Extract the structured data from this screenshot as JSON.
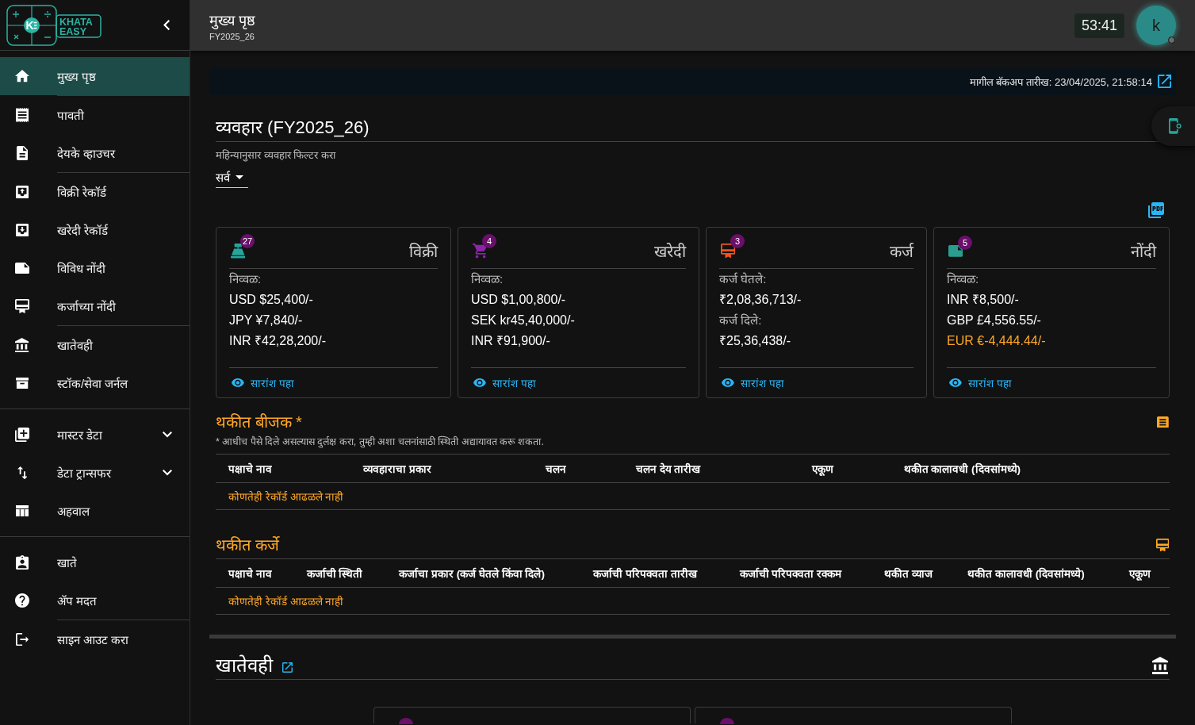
{
  "sidebar": {
    "logo": {
      "mark": "K",
      "words": [
        "KHATA",
        "EASY"
      ]
    },
    "sections": [
      {
        "groups": [
          {
            "items": [
              {
                "label": "मुख्य पृष्ठ",
                "kind": "link",
                "selected": true
              }
            ]
          },
          {
            "items": [
              {
                "label": "पावती",
                "kind": "link",
                "selected": false
              },
              {
                "label": "देयके व्हाउचर",
                "kind": "link",
                "selected": false
              }
            ]
          },
          {
            "items": [
              {
                "label": "विक्री रेकॉर्ड",
                "kind": "link",
                "selected": false
              },
              {
                "label": "खरेदी रेकॉर्ड",
                "kind": "link",
                "selected": false
              },
              {
                "label": "विविध नोंदी",
                "kind": "link",
                "selected": false
              },
              {
                "label": "कर्जाच्या नोंदी",
                "kind": "link",
                "selected": false
              }
            ]
          },
          {
            "items": [
              {
                "label": "खातेवही",
                "kind": "link",
                "selected": false
              },
              {
                "label": "स्टॉक/सेवा जर्नल",
                "kind": "link",
                "selected": false
              }
            ]
          }
        ]
      },
      {
        "groups": [
          {
            "items": [
              {
                "label": "मास्टर डेटा",
                "kind": "menu",
                "expanded": false,
                "selected": false
              },
              {
                "label": "डेटा ट्रान्सफर",
                "kind": "menu",
                "expanded": false,
                "selected": false
              },
              {
                "label": "अहवाल",
                "kind": "link",
                "selected": false
              }
            ]
          }
        ]
      },
      {
        "groups": [
          {
            "items": [
              {
                "label": "खाते",
                "kind": "link",
                "selected": false
              },
              {
                "label": "ॲप मदत",
                "kind": "link",
                "selected": false
              }
            ]
          },
          {
            "items": [
              {
                "label": "साइन आउट करा",
                "kind": "link",
                "selected": false
              }
            ]
          }
        ]
      }
    ]
  },
  "header": {
    "title": "मुख्य पृष्ठ",
    "subtitle": "FY2025_26",
    "timer": "53:41",
    "avatar": {
      "initial": "k",
      "online": false
    }
  },
  "backup_banner": {
    "text": "मागील बॅकअप तारीख: 23/04/2025, 21:58:14"
  },
  "transactions": {
    "title": "व्यवहार (FY2025_26)",
    "filter": {
      "label": "महिन्यानुसार व्यवहार फिल्टर करा",
      "value": "सर्व"
    },
    "cards": [
      {
        "title": "विक्री",
        "count": "27",
        "color": "#26a69a",
        "lines": [
          {
            "kind": "label",
            "text": "निव्वळ:"
          },
          {
            "kind": "amount",
            "text": "USD $25,400/-",
            "negative": false
          },
          {
            "kind": "amount",
            "text": "JPY ¥7,840/-",
            "negative": false
          },
          {
            "kind": "amount",
            "text": "INR ₹42,28,200/-",
            "negative": false
          }
        ],
        "link": "सारांश पहा"
      },
      {
        "title": "खरेदी",
        "count": "4",
        "color": "#8e24aa",
        "lines": [
          {
            "kind": "label",
            "text": "निव्वळ:"
          },
          {
            "kind": "amount",
            "text": "USD $1,00,800/-",
            "negative": false
          },
          {
            "kind": "amount",
            "text": "SEK kr45,40,000/-",
            "negative": false
          },
          {
            "kind": "amount",
            "text": "INR ₹91,900/-",
            "negative": false
          }
        ],
        "link": "सारांश पहा"
      },
      {
        "title": "कर्ज",
        "count": "3",
        "color": "#f4511e",
        "lines": [
          {
            "kind": "label",
            "text": "कर्ज घेतले:"
          },
          {
            "kind": "amount",
            "text": "₹2,08,36,713/-",
            "negative": false
          },
          {
            "kind": "label",
            "text": "कर्ज दिले:"
          },
          {
            "kind": "amount",
            "text": "₹25,36,438/-",
            "negative": false
          }
        ],
        "link": "सारांश पहा"
      },
      {
        "title": "नोंदी",
        "count": "5",
        "color": "#2a9d8f",
        "lines": [
          {
            "kind": "label",
            "text": "निव्वळ:"
          },
          {
            "kind": "amount",
            "text": "INR ₹8,500/-",
            "negative": false
          },
          {
            "kind": "amount",
            "text": "GBP £4,556.55/-",
            "negative": false
          },
          {
            "kind": "amount",
            "text": "EUR €-4,444.44/-",
            "negative": true
          }
        ],
        "link": "सारांश पहा"
      }
    ]
  },
  "overdue_invoices": {
    "title": "थकीत बीजक *",
    "note": "* आधीच पैसे दिले असल्यास दुर्लक्ष करा, तुम्ही अशा चलनांसाठी स्थिती अद्यायावत करू शकता.",
    "columns": [
      "पक्षाचे नाव",
      "व्यवहाराचा प्रकार",
      "चलन",
      "चलन देय तारीख",
      "एकूण",
      "थकीत कालावधी (दिवसांमध्ये)"
    ],
    "empty_message": "कोणतेही रेकॉर्ड आढळले नाही"
  },
  "overdue_loans": {
    "title": "थकीत कर्जे",
    "columns": [
      "पक्षाचे नाव",
      "कर्जाची स्थिती",
      "कर्जाचा प्रकार (कर्ज घेतले किंवा दिले)",
      "कर्जाची परिपक्वता तारीख",
      "कर्जाची परिपक्वता रक्कम",
      "थकीत व्याज",
      "थकीत कालावधी (दिवसांमध्ये)",
      "एकूण"
    ],
    "empty_message": "कोणतेही रेकॉर्ड आढळले नाही"
  },
  "ledger": {
    "title": "खातेवही",
    "cards": [
      {
        "kind": "account"
      },
      {
        "kind": "account"
      }
    ]
  }
}
